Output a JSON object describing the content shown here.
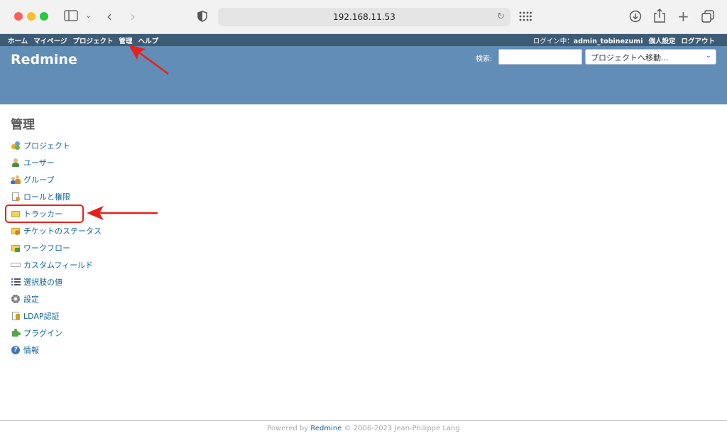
{
  "browser": {
    "url": "192.168.11.53"
  },
  "top_menu": {
    "items": [
      "ホーム",
      "マイページ",
      "プロジェクト",
      "管理",
      "ヘルプ"
    ],
    "logged_in_label": "ログイン中：",
    "username": "admin_tobinezumi",
    "my_account": "個人設定",
    "logout": "ログアウト"
  },
  "header": {
    "site_title": "Redmine",
    "search_label": "検索:",
    "project_jump": "プロジェクトへ移動..."
  },
  "main": {
    "title": "管理",
    "admin_menu": [
      {
        "label": "プロジェクト",
        "icon": "projects-icon"
      },
      {
        "label": "ユーザー",
        "icon": "user-icon"
      },
      {
        "label": "グループ",
        "icon": "group-icon"
      },
      {
        "label": "ロールと権限",
        "icon": "roles-icon"
      },
      {
        "label": "トラッカー",
        "icon": "tracker-icon"
      },
      {
        "label": "チケットのステータス",
        "icon": "issue-status-icon"
      },
      {
        "label": "ワークフロー",
        "icon": "workflow-icon"
      },
      {
        "label": "カスタムフィールド",
        "icon": "custom-field-icon"
      },
      {
        "label": "選択肢の値",
        "icon": "enumeration-list-icon"
      },
      {
        "label": "設定",
        "icon": "settings-gear-icon"
      },
      {
        "label": "LDAP認証",
        "icon": "ldap-icon"
      },
      {
        "label": "プラグイン",
        "icon": "plugin-icon"
      },
      {
        "label": "情報",
        "icon": "info-icon"
      }
    ]
  },
  "footer": {
    "powered_by": "Powered by",
    "link": "Redmine",
    "copyright": "© 2006-2023 Jean-Philippe Lang"
  },
  "annotation_color": "#e8201b"
}
